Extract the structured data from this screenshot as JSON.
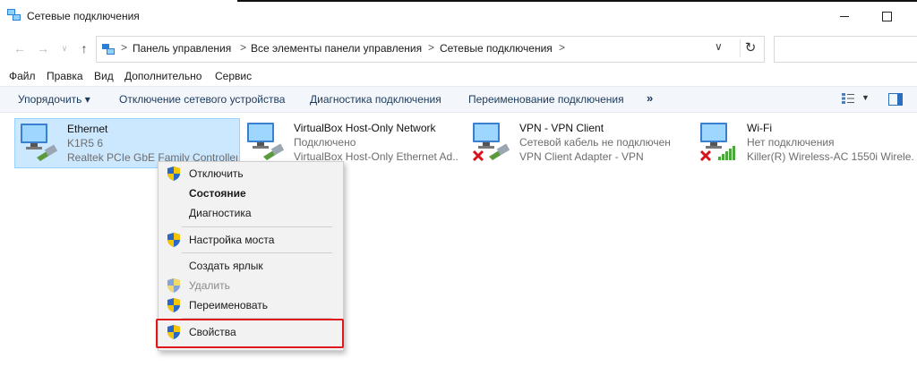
{
  "window": {
    "title": "Сетевые подключения"
  },
  "address_bar": {
    "breadcrumbs": [
      "Панель управления",
      "Все элементы панели управления",
      "Сетевые подключения"
    ],
    "search_placeholder": ""
  },
  "menubar": {
    "items": [
      "Файл",
      "Правка",
      "Вид",
      "Дополнительно",
      "Сервис"
    ]
  },
  "commandbar": {
    "organize": "Упорядочить ▾",
    "items": [
      "Отключение сетевого устройства",
      "Диагностика подключения",
      "Переименование подключения"
    ],
    "more": "»"
  },
  "connections": [
    {
      "name": "Ethernet",
      "status": "K1R5 6",
      "device": "Realtek PCIe GbE Family Controller",
      "icon": "ethernet-connected-icon"
    },
    {
      "name": "VirtualBox Host-Only Network",
      "status": "Подключено",
      "device": "VirtualBox Host-Only Ethernet Ad...",
      "icon": "ethernet-connected-icon"
    },
    {
      "name": "VPN - VPN Client",
      "status": "Сетевой кабель не подключен",
      "device": "VPN Client Adapter - VPN",
      "icon": "ethernet-disconnected-icon"
    },
    {
      "name": "Wi-Fi",
      "status": "Нет подключения",
      "device": "Killer(R) Wireless-AC 1550i Wirele...",
      "icon": "wifi-disconnected-icon"
    }
  ],
  "context_menu": {
    "items": [
      {
        "label": "Отключить",
        "shield": true,
        "style": "normal"
      },
      {
        "label": "Состояние",
        "shield": false,
        "style": "bold"
      },
      {
        "label": "Диагностика",
        "shield": false,
        "style": "normal"
      },
      {
        "label": "Настройка моста",
        "shield": true,
        "style": "normal"
      },
      {
        "label": "Создать ярлык",
        "shield": false,
        "style": "normal"
      },
      {
        "label": "Удалить",
        "shield": true,
        "style": "disabled"
      },
      {
        "label": "Переименовать",
        "shield": true,
        "style": "normal"
      },
      {
        "label": "Свойства",
        "shield": true,
        "style": "normal"
      }
    ],
    "highlighted_item": "Свойства"
  },
  "colors": {
    "selection": "#cce8ff",
    "highlight_border": "#e0181c",
    "shield_blue": "#2b67c4",
    "shield_yellow": "#f5c400"
  }
}
